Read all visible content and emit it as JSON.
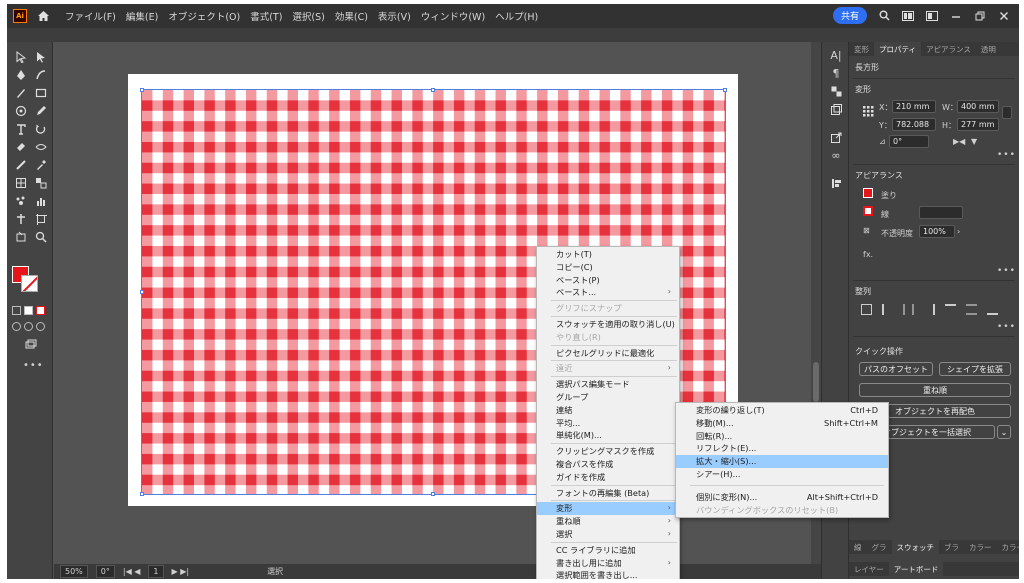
{
  "menubar": {
    "app_icon": "Ai",
    "items": [
      "ファイル(F)",
      "編集(E)",
      "オブジェクト(O)",
      "書式(T)",
      "選択(S)",
      "効果(C)",
      "表示(V)",
      "ウィンドウ(W)",
      "ヘルプ(H)"
    ],
    "share_label": "共有",
    "icons": [
      "home-icon",
      "search-icon",
      "workspace-icon",
      "arrange-icon",
      "minimize-icon",
      "restore-icon",
      "close-icon"
    ]
  },
  "statusbar": {
    "zoom": "50%",
    "rotation": "0°",
    "artboard": "1",
    "tool": "選択"
  },
  "panel": {
    "tabs": [
      "変形",
      "プロパティ",
      "アピアランス",
      "透明"
    ],
    "active_tab": "プロパティ",
    "object_type": "長方形",
    "transform_title": "変形",
    "x_label": "X：",
    "x_value": "210 mm",
    "y_label": "Y：",
    "y_value": "782.088",
    "w_label": "W：",
    "w_value": "400 mm",
    "h_label": "H：",
    "h_value": "277 mm",
    "angle_value": "0°",
    "appearance_title": "アピアランス",
    "fill_label": "塗り",
    "stroke_label": "線",
    "opacity_label": "不透明度",
    "opacity_value": "100%",
    "fx_label": "fx.",
    "align_title": "整列",
    "quick_title": "クイック操作",
    "btn_path_offset": "パスのオフセット",
    "btn_expand_shape": "シェイプを拡張",
    "btn_arrange": "重ね順",
    "btn_recolor": "オブジェクトを再配色",
    "btn_select_same": "オブジェクトを一括選択",
    "bottom_tabs_1": [
      "線",
      "グラ",
      "スウォッチ",
      "ブラ",
      "カラー",
      "カラー"
    ],
    "bottom_tabs_2": [
      "レイヤー",
      "アートボード"
    ]
  },
  "context_menu": {
    "items": [
      {
        "label": "カット(T)",
        "state": "normal"
      },
      {
        "label": "コピー(C)",
        "state": "normal"
      },
      {
        "label": "ペースト(P)",
        "state": "normal"
      },
      {
        "label": "ペースト...",
        "state": "submenu"
      },
      {
        "label": "グリフにスナップ",
        "state": "disabled"
      },
      {
        "label": "スウォッチを適用の取り消し(U)",
        "state": "normal"
      },
      {
        "label": "やり直し(R)",
        "state": "disabled"
      },
      {
        "label": "ピクセルグリッドに最適化",
        "state": "normal"
      },
      {
        "label": "遠近",
        "state": "disabled-submenu"
      },
      {
        "label": "選択パス編集モード",
        "state": "normal"
      },
      {
        "label": "グループ",
        "state": "normal"
      },
      {
        "label": "連結",
        "state": "normal"
      },
      {
        "label": "平均...",
        "state": "normal"
      },
      {
        "label": "単純化(M)...",
        "state": "normal"
      },
      {
        "label": "クリッピングマスクを作成",
        "state": "normal"
      },
      {
        "label": "複合パスを作成",
        "state": "normal"
      },
      {
        "label": "ガイドを作成",
        "state": "normal"
      },
      {
        "label": "フォントの再編集 (Beta)",
        "state": "normal"
      },
      {
        "label": "変形",
        "state": "active-submenu"
      },
      {
        "label": "重ね順",
        "state": "submenu"
      },
      {
        "label": "選択",
        "state": "submenu"
      },
      {
        "label": "CC ライブラリに追加",
        "state": "normal"
      },
      {
        "label": "書き出し用に追加",
        "state": "submenu"
      },
      {
        "label": "選択範囲を書き出し...",
        "state": "normal"
      }
    ]
  },
  "submenu": {
    "items": [
      {
        "label": "変形の繰り返し(T)",
        "shortcut": "Ctrl+D",
        "state": "normal"
      },
      {
        "label": "移動(M)...",
        "shortcut": "Shift+Ctrl+M",
        "state": "normal"
      },
      {
        "label": "回転(R)...",
        "shortcut": "",
        "state": "normal"
      },
      {
        "label": "リフレクト(E)...",
        "shortcut": "",
        "state": "normal"
      },
      {
        "label": "拡大・縮小(S)...",
        "shortcut": "",
        "state": "active"
      },
      {
        "label": "シアー(H)...",
        "shortcut": "",
        "state": "normal"
      },
      {
        "label": "個別に変形(N)...",
        "shortcut": "Alt+Shift+Ctrl+D",
        "state": "normal"
      },
      {
        "label": "バウンディングボックスのリセット(B)",
        "shortcut": "",
        "state": "disabled"
      }
    ]
  },
  "colors": {
    "fill": "#e7141a",
    "gingham_red": "#e2000f",
    "selection": "#4f7fe0",
    "menu_highlight": "#99ccff"
  }
}
